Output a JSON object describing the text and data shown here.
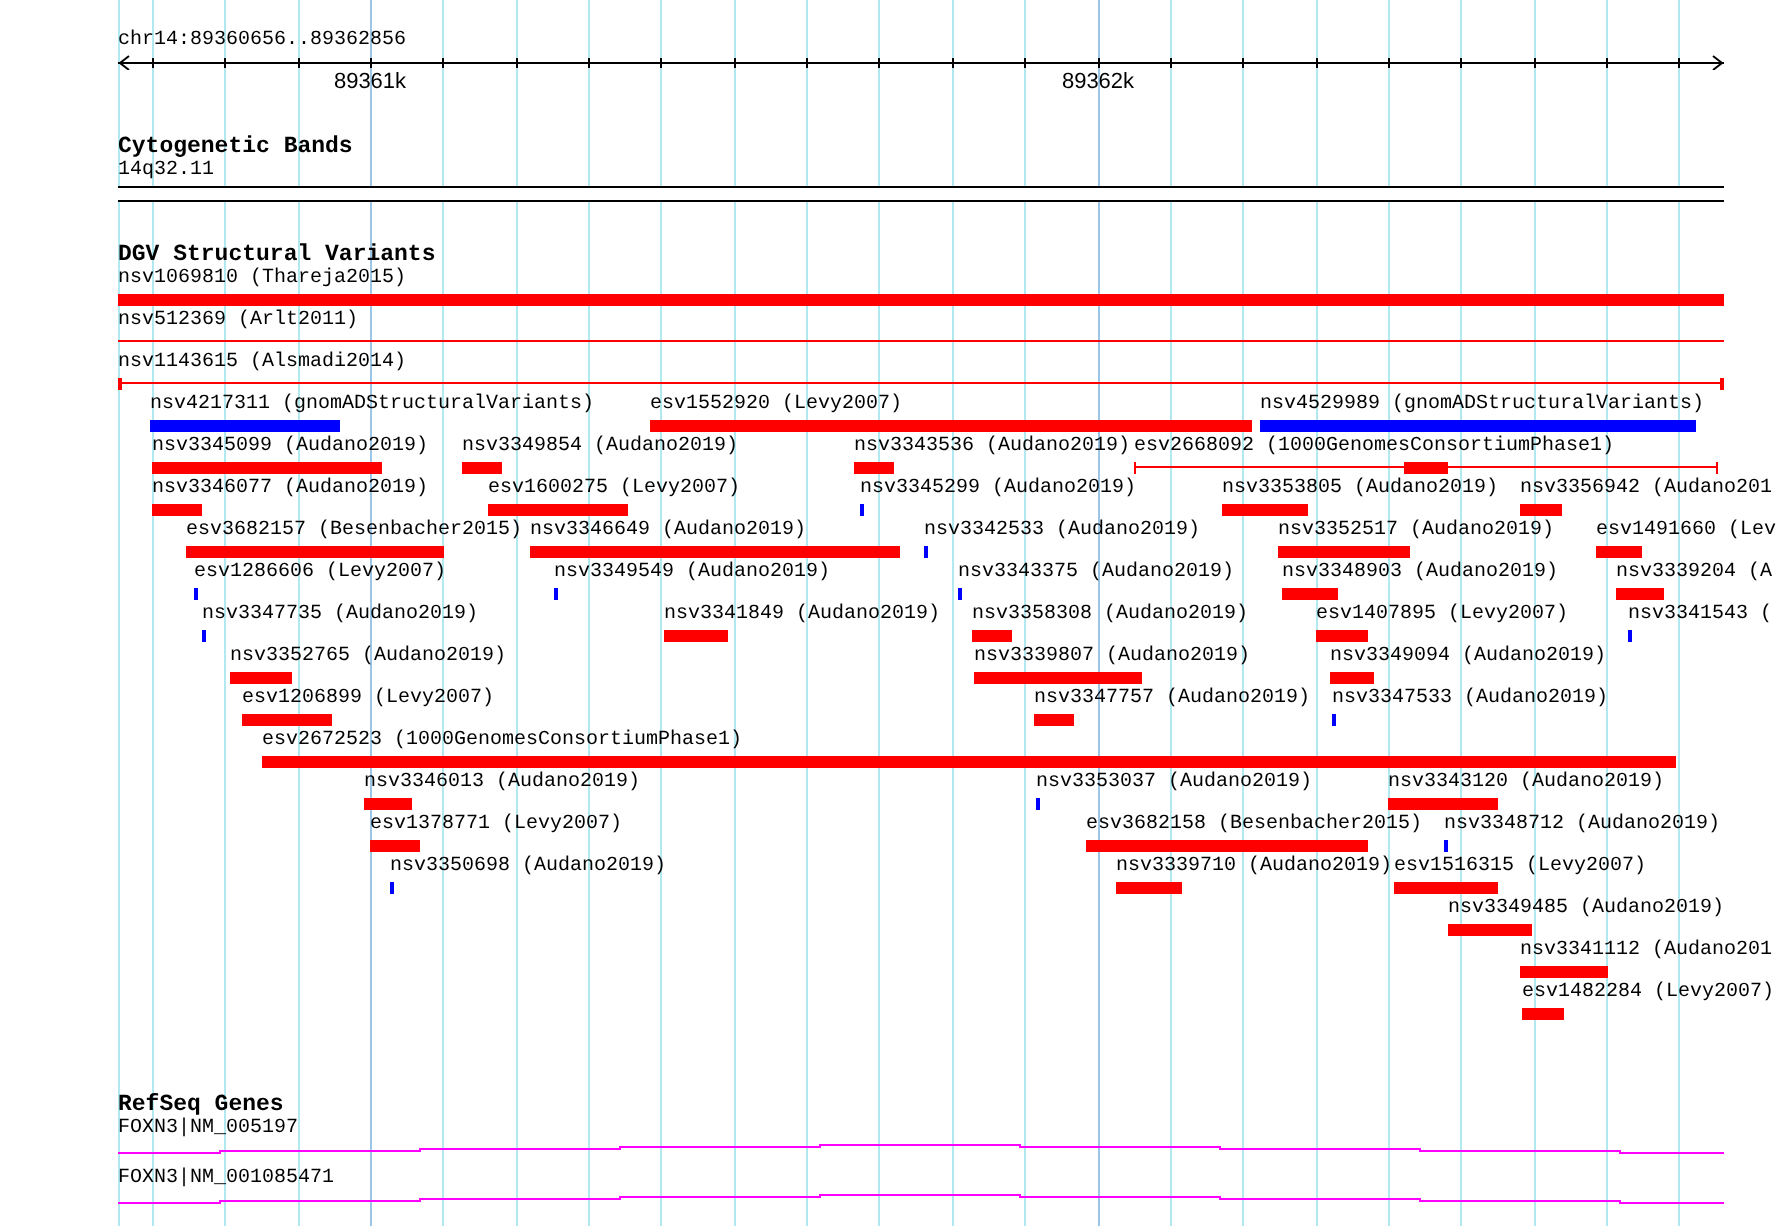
{
  "ruler": {
    "location": "chr14:89360656..89362856",
    "tick_labels": [
      "89361k",
      "89362k"
    ]
  },
  "cytogenetic_bands": {
    "title": "Cytogenetic Bands",
    "bands": [
      {
        "label": "14q32.11"
      }
    ]
  },
  "dgv_structural_variants": {
    "title": "DGV Structural Variants",
    "variants": [
      {
        "label": "nsv1069810 (Thareja2015)",
        "kind": "bar",
        "color": "#ff0000"
      },
      {
        "label": "nsv512369 (Arlt2011)",
        "kind": "line",
        "color": "#ff0000"
      },
      {
        "label": "nsv1143615 (Alsmadi2014)",
        "kind": "capped-line",
        "color": "#ff0000"
      },
      {
        "label": "nsv4217311 (gnomADStructuralVariants)",
        "kind": "bar",
        "color": "#0000ff"
      },
      {
        "label": "esv1552920 (Levy2007)",
        "kind": "bar",
        "color": "#ff0000"
      },
      {
        "label": "nsv4529989 (gnomADStructuralVariants)",
        "kind": "bar",
        "color": "#0000ff"
      },
      {
        "label": "nsv3345099 (Audano2019)",
        "kind": "bar",
        "color": "#ff0000"
      },
      {
        "label": "nsv3349854 (Audano2019)",
        "kind": "bar",
        "color": "#ff0000"
      },
      {
        "label": "nsv3343536 (Audano2019)",
        "kind": "bar",
        "color": "#ff0000"
      },
      {
        "label": "esv2668092 (1000GenomesConsortiumPhase1)",
        "kind": "capped-line-block",
        "color": "#ff0000"
      },
      {
        "label": "nsv3346077 (Audano2019)",
        "kind": "bar",
        "color": "#ff0000"
      },
      {
        "label": "esv1600275 (Levy2007)",
        "kind": "bar",
        "color": "#ff0000"
      },
      {
        "label": "nsv3345299 (Audano2019)",
        "kind": "bar",
        "color": "#0000ff"
      },
      {
        "label": "nsv3353805 (Audano2019)",
        "kind": "bar",
        "color": "#ff0000"
      },
      {
        "label": "nsv3356942 (Audano201",
        "kind": "bar",
        "color": "#ff0000"
      },
      {
        "label": "esv3682157 (Besenbacher2015)",
        "kind": "bar",
        "color": "#ff0000"
      },
      {
        "label": "nsv3346649 (Audano2019)",
        "kind": "bar",
        "color": "#ff0000"
      },
      {
        "label": "nsv3342533 (Audano2019)",
        "kind": "bar",
        "color": "#0000ff"
      },
      {
        "label": "nsv3352517 (Audano2019)",
        "kind": "bar",
        "color": "#ff0000"
      },
      {
        "label": "esv1491660 (Lev",
        "kind": "bar",
        "color": "#ff0000"
      },
      {
        "label": "esv1286606 (Levy2007)",
        "kind": "bar",
        "color": "#0000ff"
      },
      {
        "label": "nsv3349549 (Audano2019)",
        "kind": "bar",
        "color": "#0000ff"
      },
      {
        "label": "nsv3343375 (Audano2019)",
        "kind": "bar",
        "color": "#0000ff"
      },
      {
        "label": "nsv3348903 (Audano2019)",
        "kind": "bar",
        "color": "#ff0000"
      },
      {
        "label": "nsv3339204 (A",
        "kind": "bar",
        "color": "#ff0000"
      },
      {
        "label": "nsv3347735 (Audano2019)",
        "kind": "bar",
        "color": "#0000ff"
      },
      {
        "label": "nsv3341849 (Audano2019)",
        "kind": "bar",
        "color": "#ff0000"
      },
      {
        "label": "nsv3358308 (Audano2019)",
        "kind": "bar",
        "color": "#ff0000"
      },
      {
        "label": "esv1407895 (Levy2007)",
        "kind": "bar",
        "color": "#ff0000"
      },
      {
        "label": "nsv3341543 (",
        "kind": "bar",
        "color": "#0000ff"
      },
      {
        "label": "nsv3352765 (Audano2019)",
        "kind": "bar",
        "color": "#ff0000"
      },
      {
        "label": "nsv3339807 (Audano2019)",
        "kind": "bar",
        "color": "#ff0000"
      },
      {
        "label": "nsv3349094 (Audano2019)",
        "kind": "bar",
        "color": "#ff0000"
      },
      {
        "label": "esv1206899 (Levy2007)",
        "kind": "bar",
        "color": "#ff0000"
      },
      {
        "label": "nsv3347757 (Audano2019)",
        "kind": "bar",
        "color": "#ff0000"
      },
      {
        "label": "nsv3347533 (Audano2019)",
        "kind": "bar",
        "color": "#0000ff"
      },
      {
        "label": "esv2672523 (1000GenomesConsortiumPhase1)",
        "kind": "bar",
        "color": "#ff0000"
      },
      {
        "label": "nsv3346013 (Audano2019)",
        "kind": "bar",
        "color": "#ff0000"
      },
      {
        "label": "nsv3353037 (Audano2019)",
        "kind": "bar",
        "color": "#0000ff"
      },
      {
        "label": "nsv3343120 (Audano2019)",
        "kind": "bar",
        "color": "#ff0000"
      },
      {
        "label": "esv1378771 (Levy2007)",
        "kind": "bar",
        "color": "#ff0000"
      },
      {
        "label": "esv3682158 (Besenbacher2015)",
        "kind": "bar",
        "color": "#ff0000"
      },
      {
        "label": "nsv3348712 (Audano2019)",
        "kind": "bar",
        "color": "#0000ff"
      },
      {
        "label": "nsv3350698 (Audano2019)",
        "kind": "bar",
        "color": "#0000ff"
      },
      {
        "label": "nsv3339710 (Audano2019)",
        "kind": "bar",
        "color": "#ff0000"
      },
      {
        "label": "esv1516315 (Levy2007)",
        "kind": "bar",
        "color": "#ff0000"
      },
      {
        "label": "nsv3349485 (Audano2019)",
        "kind": "bar",
        "color": "#ff0000"
      },
      {
        "label": "nsv3341112 (Audano201",
        "kind": "bar",
        "color": "#ff0000"
      },
      {
        "label": "esv1482284 (Levy2007)",
        "kind": "bar",
        "color": "#ff0000"
      }
    ]
  },
  "refseq_genes": {
    "title": "RefSeq Genes",
    "transcripts": [
      {
        "label": "FOXN3|NM_005197"
      },
      {
        "label": "FOXN3|NM_001085471"
      }
    ]
  }
}
